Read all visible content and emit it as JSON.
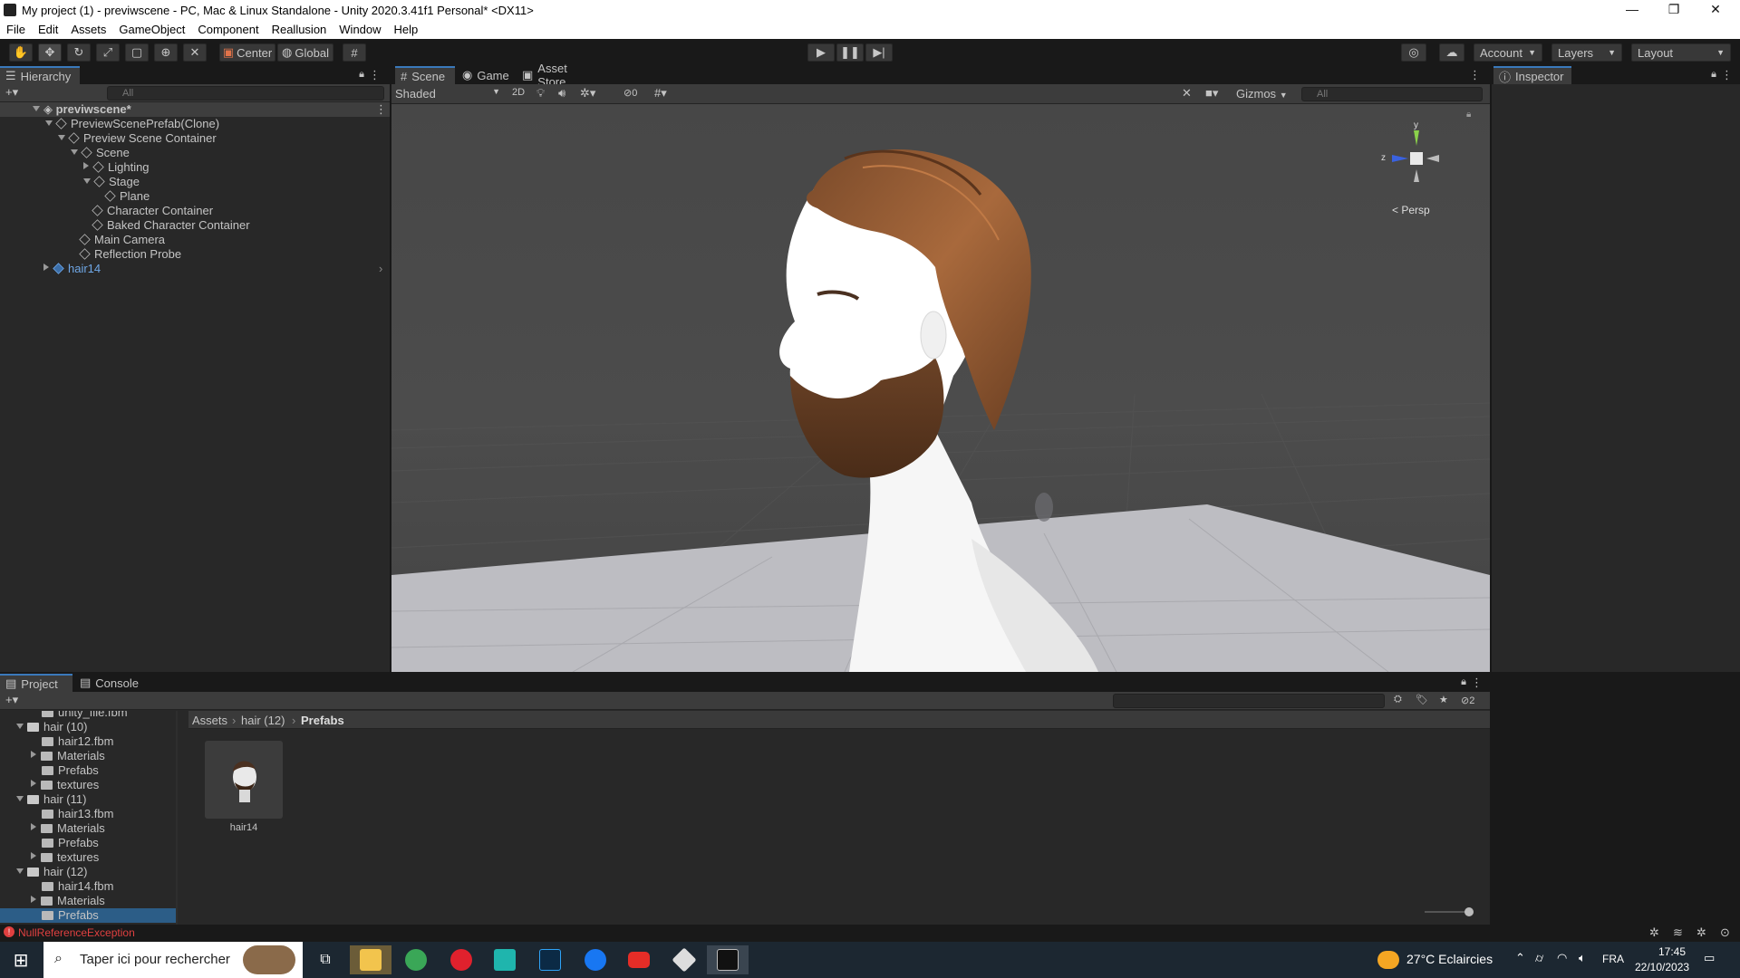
{
  "window": {
    "title": "My project (1) - previwscene - PC, Mac & Linux Standalone - Unity 2020.3.41f1 Personal* <DX11>",
    "minimize": "—",
    "restore": "❐",
    "close": "✕"
  },
  "menu": [
    "File",
    "Edit",
    "Assets",
    "GameObject",
    "Component",
    "Reallusion",
    "Window",
    "Help"
  ],
  "toolbar": {
    "pivot": "Center",
    "space": "Global",
    "account": "Account",
    "layers": "Layers",
    "layout": "Layout"
  },
  "hierarchy": {
    "tab": "Hierarchy",
    "search_placeholder": "All",
    "rows": [
      {
        "label": "previwscene*"
      },
      {
        "label": "PreviewScenePrefab(Clone)"
      },
      {
        "label": "Preview Scene Container"
      },
      {
        "label": "Scene"
      },
      {
        "label": "Lighting"
      },
      {
        "label": "Stage"
      },
      {
        "label": "Plane"
      },
      {
        "label": "Character Container"
      },
      {
        "label": "Baked Character Container"
      },
      {
        "label": "Main Camera"
      },
      {
        "label": "Reflection Probe"
      },
      {
        "label": "hair14"
      }
    ]
  },
  "scene": {
    "tabs": [
      "Scene",
      "Game",
      "Asset Store"
    ],
    "shading": "Shaded",
    "mode_2d": "2D",
    "hidden_count": "0",
    "gizmos": "Gizmos",
    "search_placeholder": "All",
    "gizmo_labels": {
      "y": "y",
      "z": "z",
      "persp": "Persp"
    }
  },
  "inspector": {
    "tab": "Inspector"
  },
  "project": {
    "tabs": [
      "Project",
      "Console"
    ],
    "tree": [
      {
        "label": "unity_file.fbm",
        "kind": "folder"
      },
      {
        "label": "hair (10)",
        "kind": "open"
      },
      {
        "label": "hair12.fbm",
        "kind": "folder"
      },
      {
        "label": "Materials",
        "kind": "folder"
      },
      {
        "label": "Prefabs",
        "kind": "folder"
      },
      {
        "label": "textures",
        "kind": "folder"
      },
      {
        "label": "hair (11)",
        "kind": "open"
      },
      {
        "label": "hair13.fbm",
        "kind": "folder"
      },
      {
        "label": "Materials",
        "kind": "folder"
      },
      {
        "label": "Prefabs",
        "kind": "folder"
      },
      {
        "label": "textures",
        "kind": "folder"
      },
      {
        "label": "hair (12)",
        "kind": "open"
      },
      {
        "label": "hair14.fbm",
        "kind": "folder"
      },
      {
        "label": "Materials",
        "kind": "folder"
      },
      {
        "label": "Prefabs",
        "kind": "folder"
      }
    ],
    "breadcrumb": [
      "Assets",
      "hair (12)",
      "Prefabs"
    ],
    "asset": "hair14",
    "hidden_count": "2"
  },
  "status": {
    "error": "NullReferenceException"
  },
  "taskbar": {
    "search": "Taper ici pour rechercher",
    "weather": "27°C  Eclaircies",
    "lang": "FRA",
    "time": "17:45",
    "date": "22/10/2023"
  },
  "colors": {
    "accent": "#3a79bb",
    "selection": "#2c5d87",
    "error": "#e04040"
  }
}
